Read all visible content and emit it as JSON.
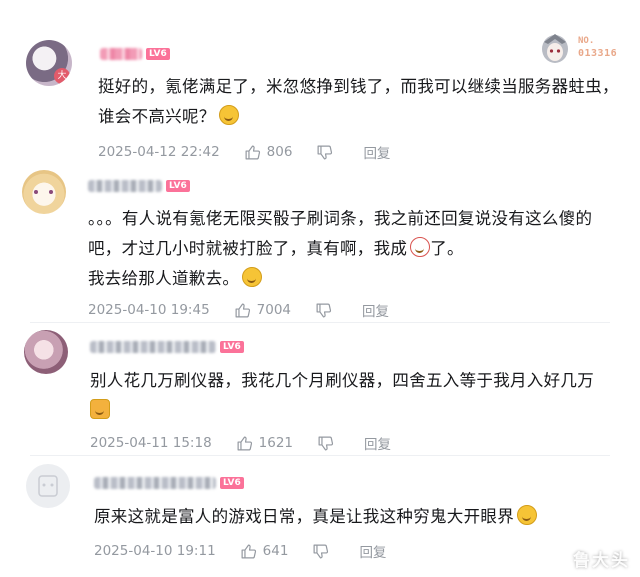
{
  "colors": {
    "level_badge": "#fb7299",
    "meta_text": "#9499a0",
    "body_text": "#18191c"
  },
  "badge": {
    "prefix": "NO.",
    "number": "013316"
  },
  "watermark": "鲁大头",
  "comments": [
    {
      "level": "LV6",
      "lines": [
        "挺好的，氪佬满足了，米忽悠挣到钱了，而我可以继续当服务器蛀虫，",
        "谁会不高兴呢？"
      ],
      "emoji": "smirk-emoji",
      "date": "2025-04-12 22:42",
      "likes": "806",
      "reply": "回复"
    },
    {
      "level": "LV6",
      "lines": [
        "。。。有人说有氪佬无限买骰子刷词条，我之前还回复说没有这么傻的",
        "吧，才过几小时就被打脸了，真有啊，我成",
        "我去给那人道歉去。"
      ],
      "line2_suffix": "了。",
      "emoji": "clown-emoji",
      "emoji2": "cry-laugh-emoji",
      "date": "2025-04-10 19:45",
      "likes": "7004",
      "reply": "回复"
    },
    {
      "level": "LV6",
      "lines": [
        "别人花几万刷仪器，我花几个月刷仪器，四舍五入等于我月入好几万"
      ],
      "emoji": "dog-emoji",
      "date": "2025-04-11 15:18",
      "likes": "1621",
      "reply": "回复"
    },
    {
      "level": "LV6",
      "lines": [
        "原来这就是富人的游戏日常，真是让我这种穷鬼大开眼界"
      ],
      "emoji": "cry-laugh-emoji",
      "date": "2025-04-10 19:11",
      "likes": "641",
      "reply": "回复"
    }
  ]
}
